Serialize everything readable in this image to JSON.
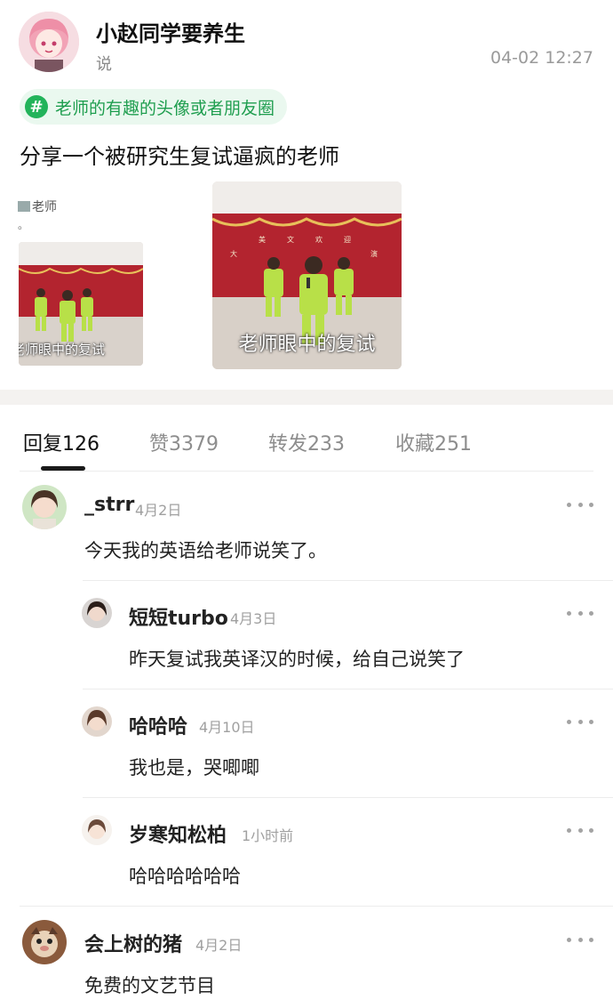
{
  "post": {
    "author": "小赵同学要养生",
    "sub_label": "说",
    "time": "04-02 12:27",
    "topic": "老师的有趣的头像或者朋友圈",
    "topic_icon": "hash-icon",
    "body": "分享一个被研究生复试逼疯的老师",
    "images": [
      {
        "top_caption": "老师",
        "top_caption2": "。",
        "caption": "老师眼中的复试"
      },
      {
        "caption": "老师眼中的复试",
        "banner": "大 美 文 欢 迎 來 演"
      }
    ]
  },
  "tabs": [
    {
      "label": "回复",
      "count": "126",
      "active": true
    },
    {
      "label": "赞",
      "count": "3379",
      "active": false
    },
    {
      "label": "转发",
      "count": "233",
      "active": false
    },
    {
      "label": "收藏",
      "count": "251",
      "active": false
    }
  ],
  "comments": [
    {
      "name": "_strr",
      "date": "4月2日",
      "text": "今天我的英语给老师说笑了。"
    },
    {
      "name": "短短turbo",
      "date": "4月3日",
      "text": "昨天复试我英译汉的时候，给自己说笑了"
    },
    {
      "name": "哈哈哈",
      "date": "4月10日",
      "text": "我也是，哭唧唧"
    },
    {
      "name": "岁寒知松柏",
      "date": "1小时前",
      "text": "哈哈哈哈哈哈"
    },
    {
      "name": "会上树的猪",
      "date": "4月2日",
      "text": "免费的文艺节目"
    }
  ],
  "colors": {
    "accent_green": "#22b35a",
    "tag_bg": "#eaf8ef",
    "muted": "#9a9a9a",
    "stage_red": "#b3242f",
    "kid_green": "#b8e048"
  },
  "icons": {
    "more": "more-dots-icon"
  }
}
